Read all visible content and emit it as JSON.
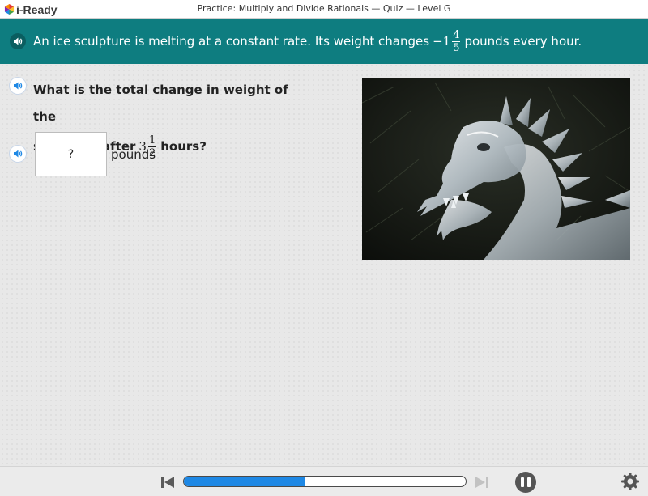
{
  "app": {
    "logo_text": "i-Ready",
    "window_title": "Practice: Multiply and Divide Rationals — Quiz — Level G"
  },
  "prompt": {
    "text_before": "An ice sculpture is melting at a constant rate. Its weight changes",
    "value_whole": "−1",
    "value_numerator": "4",
    "value_denominator": "5",
    "text_after": "pounds every hour."
  },
  "question": {
    "line1": "What is the total change in weight of the",
    "line2_before": "sculpture after",
    "value_whole": "3",
    "value_numerator": "1",
    "value_denominator": "2",
    "line2_after": "hours?"
  },
  "answer": {
    "value": "?",
    "unit": "pounds"
  },
  "image": {
    "subject": "ice dragon sculpture photo"
  },
  "controls": {
    "progress_fraction": 0.43,
    "back_icon": "skip-back-icon",
    "forward_icon": "skip-forward-icon",
    "pause_icon": "pause-icon",
    "settings_icon": "gear-icon"
  },
  "colors": {
    "banner": "#0e7d80",
    "progress": "#1e88e5",
    "speaker": "#1e88e5"
  }
}
